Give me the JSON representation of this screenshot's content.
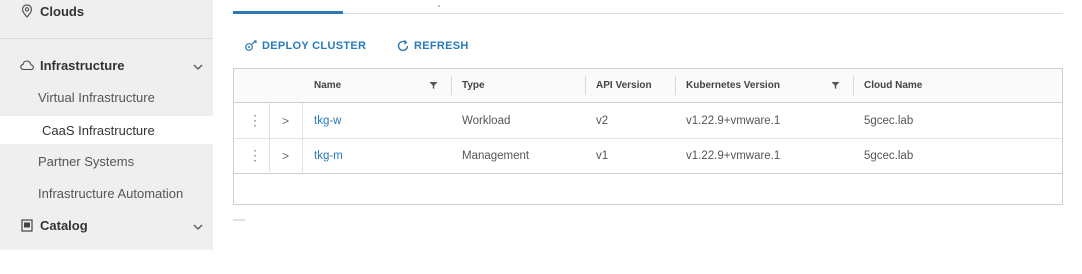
{
  "sidebar": {
    "clouds": {
      "label": "Clouds",
      "icon": "location-pin-icon"
    },
    "infrastructure": {
      "label": "Infrastructure",
      "icon": "cloud-outline-icon",
      "items": [
        {
          "label": "Virtual Infrastructure",
          "active": false
        },
        {
          "label": "CaaS Infrastructure",
          "active": true
        },
        {
          "label": "Partner Systems",
          "active": false
        },
        {
          "label": "Infrastructure Automation",
          "active": false
        }
      ]
    },
    "catalog": {
      "label": "Catalog",
      "icon": "catalog-icon"
    }
  },
  "toolbar": {
    "deploy_label": "DEPLOY CLUSTER",
    "refresh_label": "REFRESH"
  },
  "table": {
    "columns": [
      "Name",
      "Type",
      "API Version",
      "Kubernetes Version",
      "Cloud Name"
    ],
    "rows": [
      {
        "name": "tkg-w",
        "type": "Workload",
        "api": "v2",
        "k8s": "v1.22.9+vmware.1",
        "cloud": "5gcec.lab"
      },
      {
        "name": "tkg-m",
        "type": "Management",
        "api": "v1",
        "k8s": "v1.22.9+vmware.1",
        "cloud": "5gcec.lab"
      }
    ]
  },
  "colors": {
    "accent": "#2a7ab8",
    "sidebar_bg": "#efefef",
    "active_bg": "#ffffff"
  }
}
